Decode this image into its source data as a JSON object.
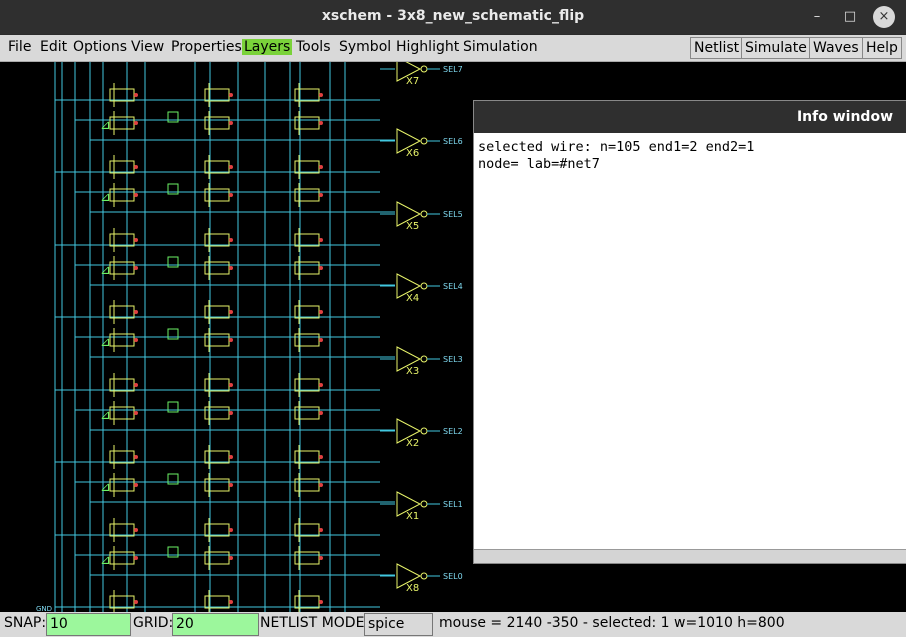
{
  "window": {
    "title": "xschem - 3x8_new_schematic_flip",
    "minimize": "–",
    "maximize": "□",
    "close": "×"
  },
  "menus": [
    "File",
    "Edit",
    "Options",
    "View",
    "Properties",
    "Layers",
    "Tools",
    "Symbol",
    "Highlight",
    "Simulation"
  ],
  "active_menu": "Layers",
  "right_buttons": [
    "Netlist",
    "Simulate",
    "Waves",
    "Help"
  ],
  "schematic": {
    "outputs": [
      "SEL7",
      "SEL6",
      "SEL5",
      "SEL4",
      "SEL3",
      "SEL2",
      "SEL1",
      "SEL0"
    ],
    "inverters": [
      "X7",
      "X6",
      "X5",
      "X4",
      "X3",
      "X2",
      "X1",
      "X8"
    ],
    "gnd_label": "GND",
    "colors": {
      "wire": "#42c8e0",
      "device": "#e8f46a",
      "accent": "#6cf266",
      "pin": "#e04040",
      "text": "#7fd9f0"
    }
  },
  "info_window": {
    "title": "Info window",
    "line1": "selected wire: n=105 end1=2 end2=1",
    "line2": "node= lab=#net7"
  },
  "status": {
    "snap_label": "SNAP:",
    "snap_value": "10",
    "grid_label": "GRID:",
    "grid_value": "20",
    "netlist_label": "NETLIST MODE:",
    "netlist_value": "spice",
    "mouse_text": "mouse = 2140 -350 - selected: 1 w=1010 h=800"
  }
}
